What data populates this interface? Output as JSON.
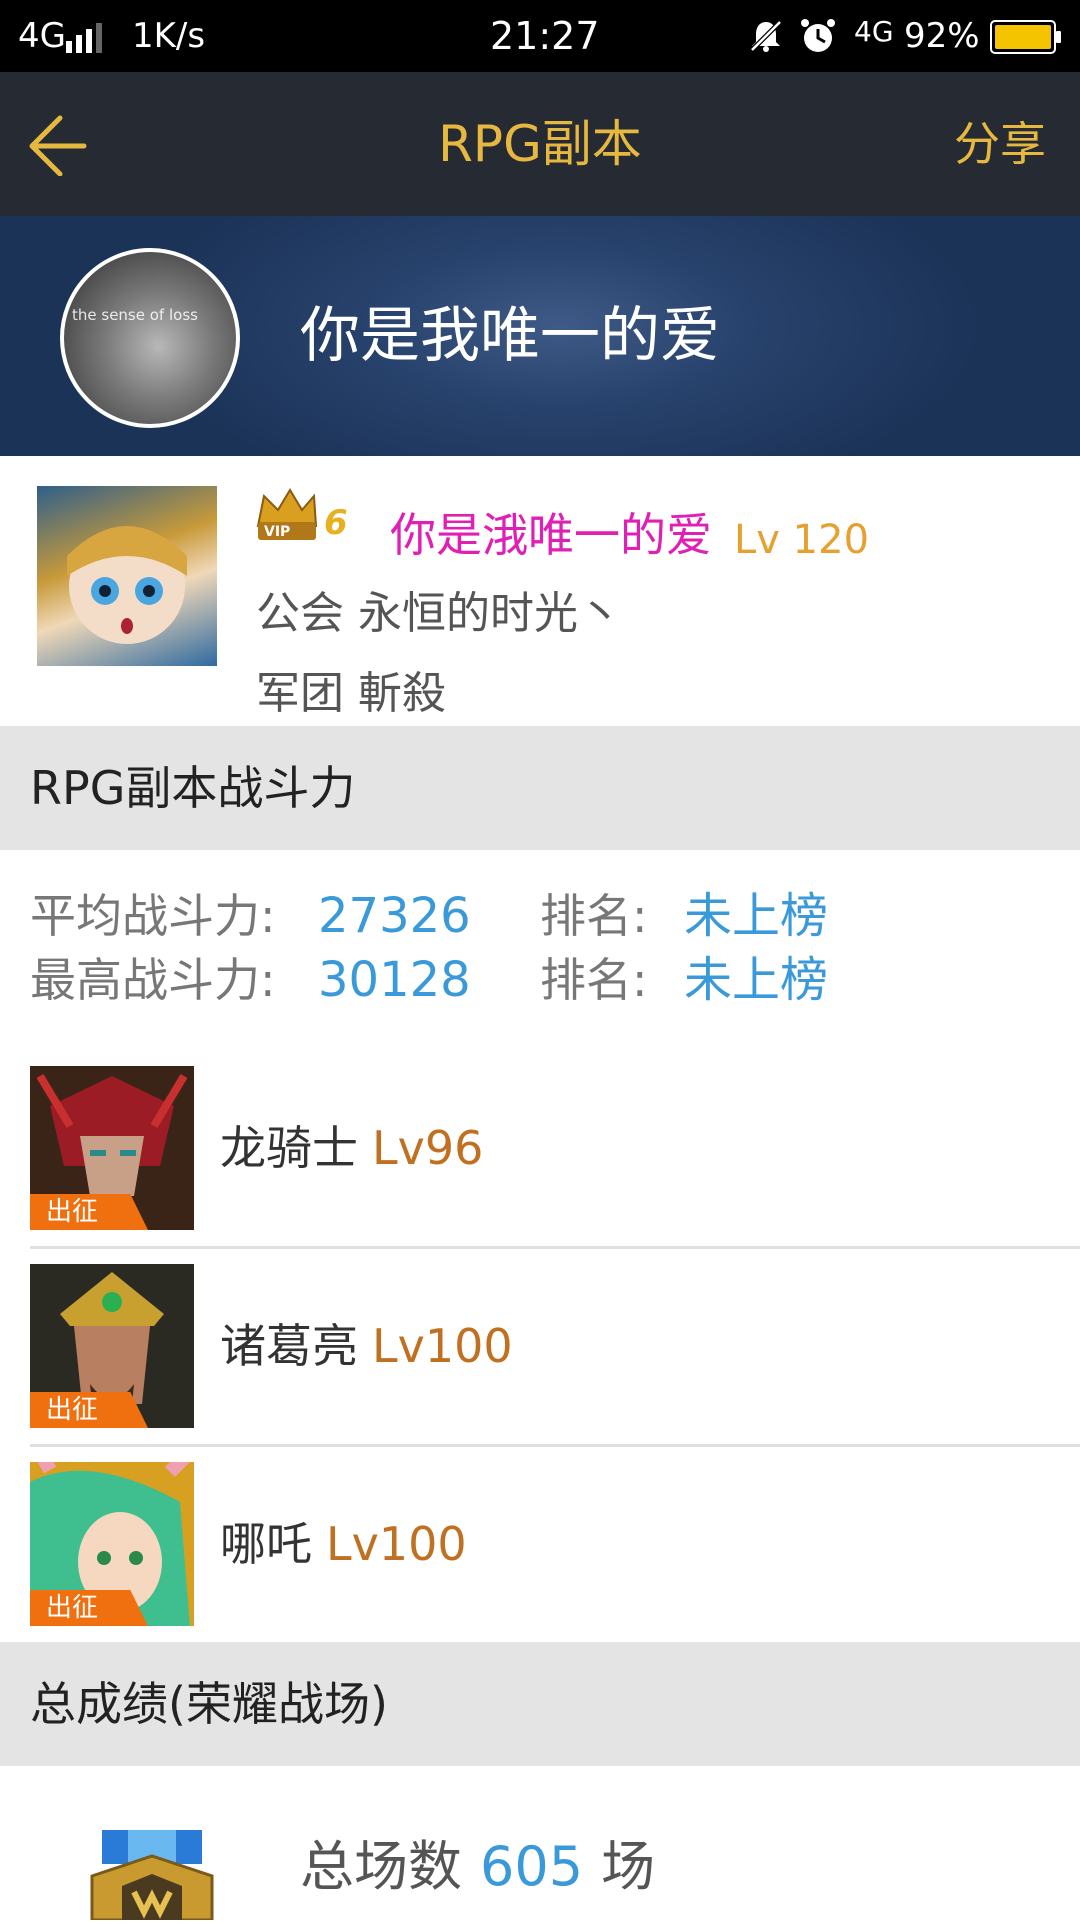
{
  "status_bar": {
    "network": "4G",
    "speed": "1K/s",
    "time": "21:27",
    "network2": "4G",
    "battery": "92%"
  },
  "nav": {
    "title": "RPG副本",
    "share_label": "分享",
    "back_icon": "back-arrow-icon"
  },
  "banner": {
    "name": "你是我唯一的爱",
    "avatar_text": "the sense of loss"
  },
  "player": {
    "vip": "VIP6",
    "name": "你是涐唯一的爱",
    "level": "Lv 120",
    "guild_line": "公会 永恒的时光丶",
    "legion_line": "军团 斬殺"
  },
  "rpg_section": {
    "title": "RPG副本战斗力",
    "avg_label": "平均战斗力:",
    "avg_value": "27326",
    "max_label": "最高战斗力:",
    "max_value": "30128",
    "rank_label": "排名:",
    "avg_rank": "未上榜",
    "max_rank": "未上榜"
  },
  "heroes": [
    {
      "name": "龙骑士",
      "level": "Lv96",
      "tag": "出征",
      "accent": "#9b1c24"
    },
    {
      "name": "诸葛亮",
      "level": "Lv100",
      "tag": "出征",
      "accent": "#8a6a2a"
    },
    {
      "name": "哪吒",
      "level": "Lv100",
      "tag": "出征",
      "accent": "#3fbf8f"
    }
  ],
  "total_section": {
    "title": "总成绩(荣耀战场)",
    "total_games_label": "总场数",
    "total_games_value": "605",
    "total_games_unit": "场"
  },
  "colors": {
    "accent_gold": "#e6b840",
    "value_blue": "#3a99d8",
    "name_magenta": "#e01fb5",
    "level_orange": "#c07020",
    "tag_orange": "#f07010"
  }
}
